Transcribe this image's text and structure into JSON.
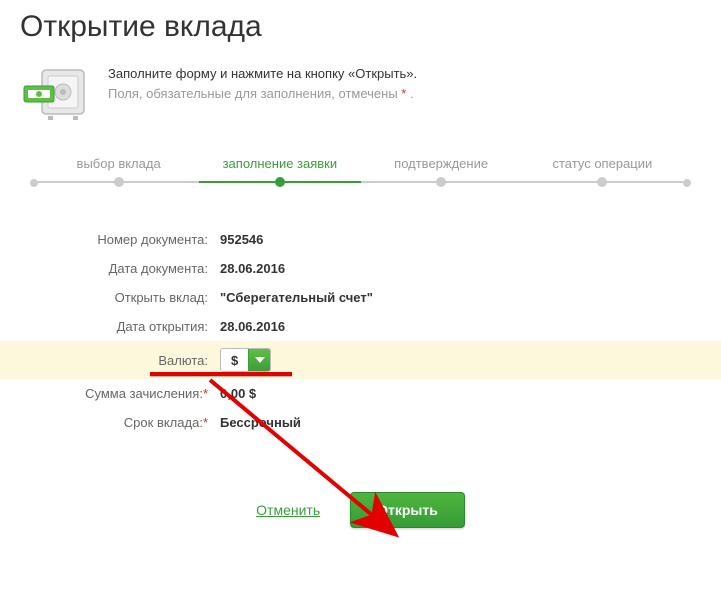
{
  "title": "Открытие вклада",
  "instruction": {
    "main": "Заполните форму и нажмите на кнопку «Открыть».",
    "sub_prefix": "Поля, обязательные для заполнения, отмечены ",
    "sub_suffix": " ."
  },
  "stepper": {
    "step1": "выбор вклада",
    "step2": "заполнение заявки",
    "step3": "подтверждение",
    "step4": "статус операции"
  },
  "form": {
    "doc_number_label": "Номер документа:",
    "doc_number_value": "952546",
    "doc_date_label": "Дата документа:",
    "doc_date_value": "28.06.2016",
    "open_deposit_label": "Открыть вклад:",
    "open_deposit_value": "\"Сберегательный счет\"",
    "open_date_label": "Дата открытия:",
    "open_date_value": "28.06.2016",
    "currency_label": "Валюта:",
    "currency_value": "$",
    "amount_label": "Сумма зачисления:",
    "amount_value": "0,00 $",
    "term_label": "Срок вклада:",
    "term_value": "Бессрочный"
  },
  "actions": {
    "cancel": "Отменить",
    "open": "Открыть"
  }
}
